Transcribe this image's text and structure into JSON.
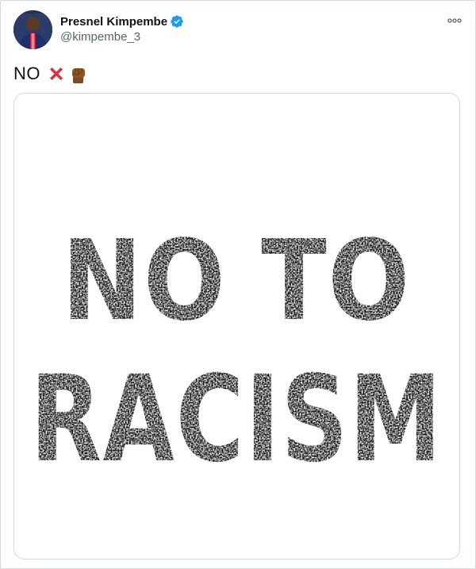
{
  "tweet": {
    "author": {
      "display_name": "Presnel Kimpembe",
      "handle": "@kimpembe_3",
      "verified": true
    },
    "text": "NO",
    "emojis": [
      "cross-mark-emoji",
      "raised-fist-medium-dark-skin-tone-emoji"
    ],
    "media": {
      "line1": "NO TO",
      "line2": "RACISM"
    }
  },
  "colors": {
    "verified_blue": "#1d9bf0",
    "text_primary": "#0f1419",
    "text_secondary": "#536471",
    "border": "#cfd9de",
    "cross_red": "#e0245e",
    "fist_brown": "#8d5524"
  },
  "icons": {
    "more": "more-dots-icon",
    "verified": "verified-badge-icon"
  }
}
